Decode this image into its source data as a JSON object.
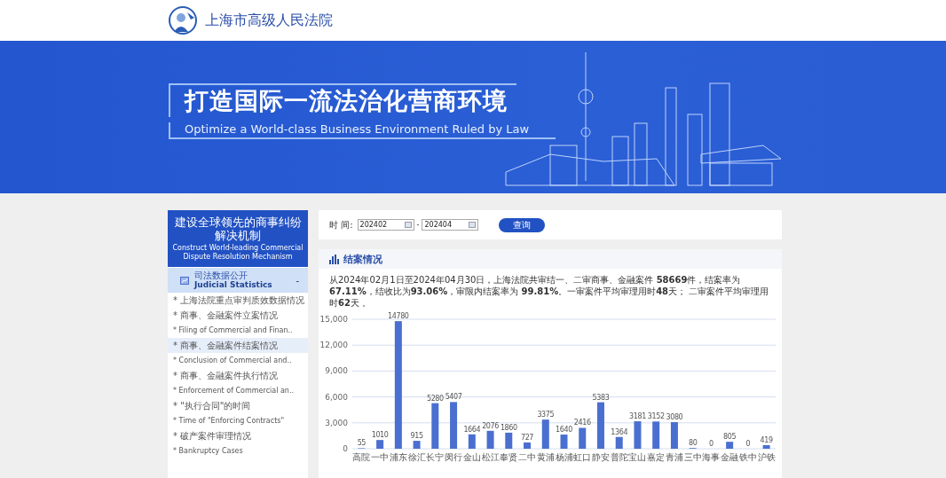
{
  "header": {
    "site_name": "上海市高级人民法院"
  },
  "banner": {
    "title": "打造国际一流法治化营商环境",
    "subtitle": "Optimize a World-class Business Environment Ruled by Law"
  },
  "sidebar": {
    "title_zh": "建设全球领先的商事纠纷解决机制",
    "title_en": "Construct World-leading Commercial Dispute Resolution Mechanism",
    "section": {
      "label_zh": "司法数据公开",
      "label_en": "Judicial Statistics",
      "toggle": "-",
      "expanded": true
    },
    "items": [
      {
        "kind": "zh",
        "label": "* 上海法院重点审判质效数据情况",
        "selected": false
      },
      {
        "kind": "zh",
        "label": "* 商事、金融案件立案情况",
        "selected": false
      },
      {
        "kind": "en",
        "label": "* Filing of Commercial and Finan..",
        "selected": false
      },
      {
        "kind": "zh",
        "label": "* 商事、金融案件结案情况",
        "selected": true
      },
      {
        "kind": "en",
        "label": "* Conclusion of Commercial and..",
        "selected": false
      },
      {
        "kind": "zh",
        "label": "* 商事、金融案件执行情况",
        "selected": false
      },
      {
        "kind": "en",
        "label": "* Enforcement of Commercial an..",
        "selected": false
      },
      {
        "kind": "zh",
        "label": "* \"执行合同\"的时间",
        "selected": false
      },
      {
        "kind": "en",
        "label": "* Time of \"Enforcing Contracts\"",
        "selected": false
      },
      {
        "kind": "zh",
        "label": "* 破产案件审理情况",
        "selected": false
      },
      {
        "kind": "en",
        "label": "* Bankruptcy Cases",
        "selected": false
      }
    ]
  },
  "filter": {
    "label": "时 间:",
    "from": "202402",
    "separator": "-",
    "to": "202404",
    "button": "查询"
  },
  "stats": {
    "title": "结案情况",
    "summary": "从2024年02月1日至2024年04月30日，上海法院共审结一、二审商事、金融案件 **58669**件，结案率为**67.11%**，结收比为**93.06%**，审限内结案率为 **99.81%**。一审案件平均审理用时**48**天； 二审案件平均审理用时**62**天 。",
    "chart_data": {
      "type": "bar",
      "categories": [
        "高院",
        "一中",
        "浦东",
        "徐汇",
        "长宁",
        "闵行",
        "金山",
        "松江",
        "奉贤",
        "二中",
        "黄浦",
        "杨浦",
        "虹口",
        "静安",
        "普陀",
        "宝山",
        "嘉定",
        "青浦",
        "三中",
        "海事",
        "金融",
        "铁中",
        "沪铁"
      ],
      "grid": true,
      "series": [
        {
          "color": "#4a6fd0",
          "values": [
            55,
            1010,
            14780,
            915,
            5280,
            5407,
            1664,
            2076,
            1860,
            727,
            3375,
            1640,
            2416,
            5383,
            1364,
            3181,
            3152,
            3080,
            80,
            0,
            805,
            0,
            419
          ]
        }
      ],
      "ylim": [
        0,
        15000
      ],
      "yticks": [
        {
          "value": 0,
          "label": "0"
        },
        {
          "value": 3000,
          "label": "3,000"
        },
        {
          "value": 6000,
          "label": "6,000"
        },
        {
          "value": 9000,
          "label": "9,000"
        },
        {
          "value": 12000,
          "label": "12,000"
        },
        {
          "value": 15000,
          "label": "15,000"
        }
      ],
      "data_labels": true
    }
  }
}
